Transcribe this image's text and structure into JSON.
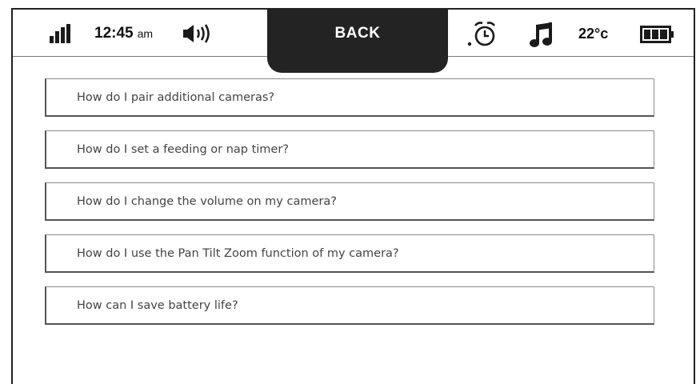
{
  "status": {
    "time": "12:45",
    "ampm": "am",
    "temperature": "22°c"
  },
  "back_button": {
    "label": "BACK"
  },
  "icons": {
    "signal": "signal-strength-icon",
    "volume": "speaker-volume-icon",
    "alarm": "alarm-clock-icon",
    "music": "music-note-icon",
    "battery": "battery-full-icon"
  },
  "faq": [
    {
      "question": "How do I pair additional cameras?"
    },
    {
      "question": "How do I set a feeding or nap timer?"
    },
    {
      "question": "How do I change the volume on my camera?"
    },
    {
      "question": "How do I use the Pan Tilt Zoom function of my camera?"
    },
    {
      "question": "How can I save battery life?"
    }
  ]
}
